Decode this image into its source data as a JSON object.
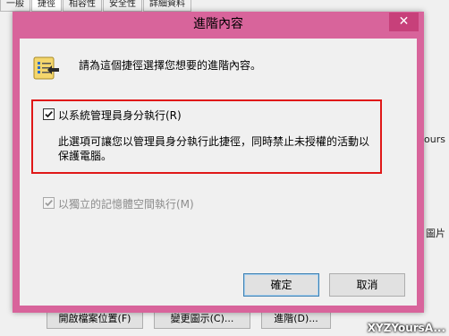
{
  "background_window": {
    "tabs": [
      "一般",
      "捷徑",
      "相容性",
      "安全性",
      "詳細資料"
    ],
    "right_edge_texts": [
      "ours",
      "圖片"
    ],
    "buttons": [
      "開啟檔案位置(F)",
      "變更圖示(C)...",
      "進階(D)..."
    ]
  },
  "watermark": "XYZYoursA...",
  "dialog": {
    "title": "進階內容",
    "close_glyph": "✕",
    "intro": "請為這個捷徑選擇您想要的進階內容。",
    "run_as_admin": {
      "label": "以系統管理員身分執行(R)",
      "checked": true,
      "description": "此選項可讓您以管理員身分執行此捷徑，同時禁止未授權的活動以保護電腦。"
    },
    "separate_memory": {
      "label": "以獨立的記憶體空間執行(M)",
      "checked": true,
      "enabled": false
    },
    "ok_label": "確定",
    "cancel_label": "取消"
  },
  "colors": {
    "accent_frame": "#d8649b",
    "close_button": "#c7407a",
    "highlight_box": "#e01818"
  }
}
